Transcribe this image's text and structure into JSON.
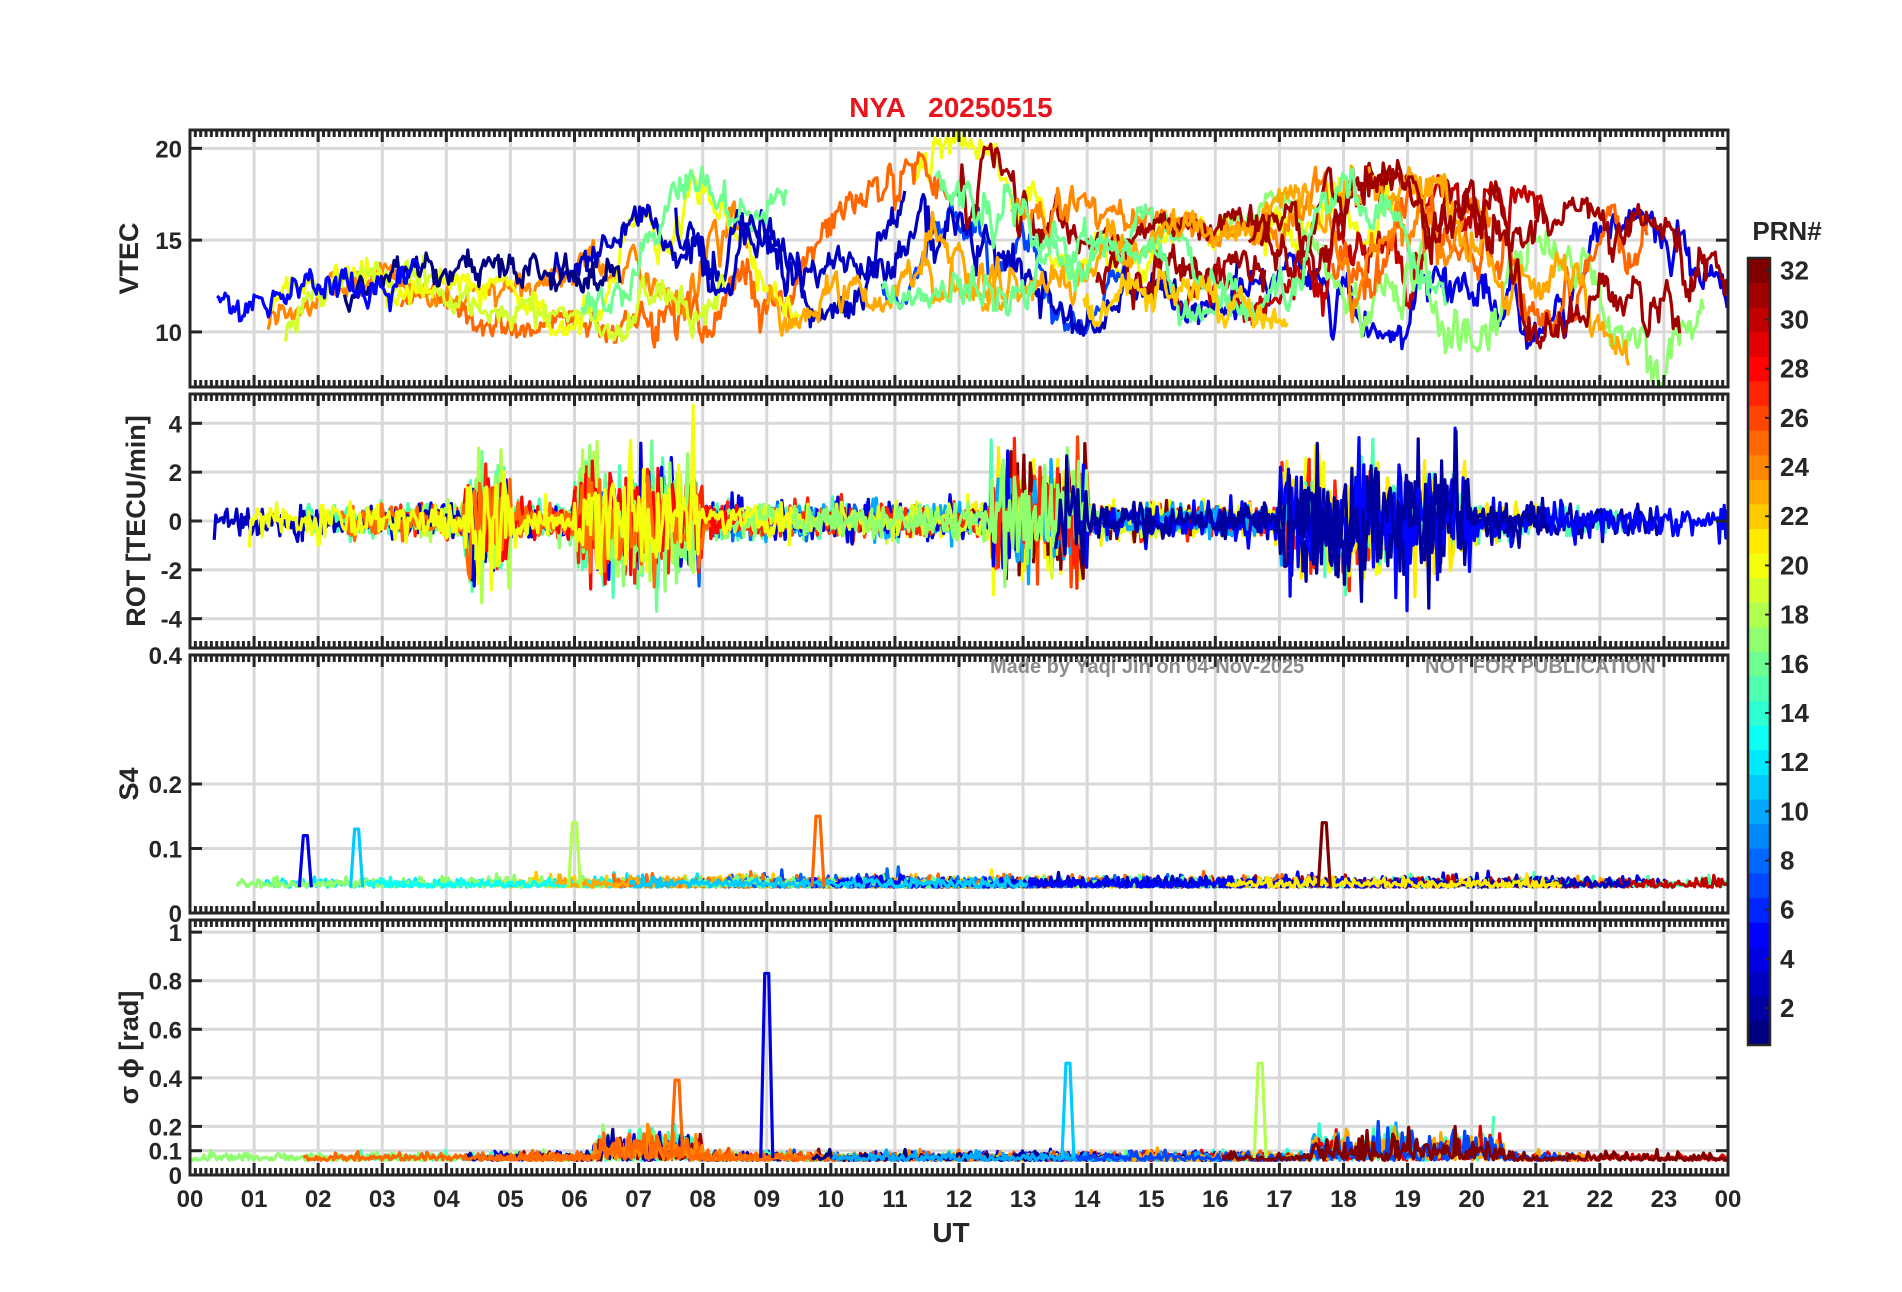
{
  "title": "NYA   20250515",
  "watermark": {
    "author_note": "Made by Yaqi Jin on 04-Nov-2025",
    "publication_note": "NOT FOR PUBLICATION"
  },
  "chart_data": [
    {
      "type": "line",
      "panel": "VTEC",
      "ylabel": "VTEC",
      "ylim": [
        7,
        21
      ],
      "yticks": [
        10,
        15,
        20
      ],
      "ytick_labels": [
        "10",
        "15",
        "20"
      ],
      "series_description": "per-PRN traces, colored by PRN#",
      "approx_envelope": {
        "x_hours": [
          0,
          2,
          4,
          6,
          8,
          10,
          12,
          14,
          16,
          18,
          20,
          22,
          23,
          24
        ],
        "y_low": [
          8,
          9,
          10,
          10,
          9,
          11,
          12,
          10,
          11,
          10,
          9,
          10,
          7,
          8
        ],
        "y_high": [
          13,
          13,
          14,
          14,
          19,
          17,
          21,
          17,
          16,
          19,
          18,
          17,
          16,
          14
        ]
      }
    },
    {
      "type": "line",
      "panel": "ROT",
      "ylabel": "ROT [TECU/min]",
      "ylim": [
        -5.2,
        5.2
      ],
      "yticks": [
        -4,
        -2,
        0,
        2,
        4
      ],
      "ytick_labels": [
        "-4",
        "-2",
        "0",
        "2",
        "4"
      ],
      "series_description": "per-PRN traces, colored by PRN#"
    },
    {
      "type": "line",
      "panel": "S4",
      "ylabel": "S4",
      "ylim": [
        0,
        0.4
      ],
      "yticks": [
        0,
        0.1,
        0.2,
        0.4
      ],
      "ytick_labels": [
        "0",
        "0.1",
        "0.2",
        "0.4"
      ],
      "series_description": "per-PRN traces, colored by PRN#",
      "notable_peaks": [
        {
          "x": 1.8,
          "y": 0.12
        },
        {
          "x": 2.6,
          "y": 0.13
        },
        {
          "x": 6.0,
          "y": 0.14
        },
        {
          "x": 9.8,
          "y": 0.15
        },
        {
          "x": 17.7,
          "y": 0.14
        }
      ]
    },
    {
      "type": "line",
      "panel": "sigma_phi",
      "ylabel": "σ ϕ [rad]",
      "ylim": [
        0,
        1.05
      ],
      "yticks": [
        0,
        0.1,
        0.2,
        0.4,
        0.6,
        0.8,
        1
      ],
      "ytick_labels": [
        "0",
        "0.1",
        "0.2",
        "0.4",
        "0.6",
        "0.8",
        "1"
      ],
      "series_description": "per-PRN traces, colored by PRN#",
      "notable_peaks": [
        {
          "x": 9.0,
          "y": 0.83
        },
        {
          "x": 13.7,
          "y": 0.46
        },
        {
          "x": 16.7,
          "y": 0.46
        },
        {
          "x": 7.6,
          "y": 0.39
        }
      ]
    }
  ],
  "xaxis": {
    "label": "UT",
    "xlim": [
      0,
      24
    ],
    "tick_labels": [
      "00",
      "01",
      "02",
      "03",
      "04",
      "05",
      "06",
      "07",
      "08",
      "09",
      "10",
      "11",
      "12",
      "13",
      "14",
      "15",
      "16",
      "17",
      "18",
      "19",
      "20",
      "21",
      "22",
      "23",
      "00"
    ]
  },
  "colorbar": {
    "title": "PRN#",
    "range": [
      1,
      32
    ],
    "tick_labels": [
      "2",
      "4",
      "6",
      "8",
      "10",
      "12",
      "14",
      "16",
      "18",
      "20",
      "22",
      "24",
      "26",
      "28",
      "30",
      "32"
    ],
    "colormap": "jet",
    "colors": [
      "#00008f",
      "#0000ff",
      "#0080ff",
      "#00ffff",
      "#80ff80",
      "#ffff00",
      "#ff8000",
      "#ff0000",
      "#800000"
    ]
  }
}
